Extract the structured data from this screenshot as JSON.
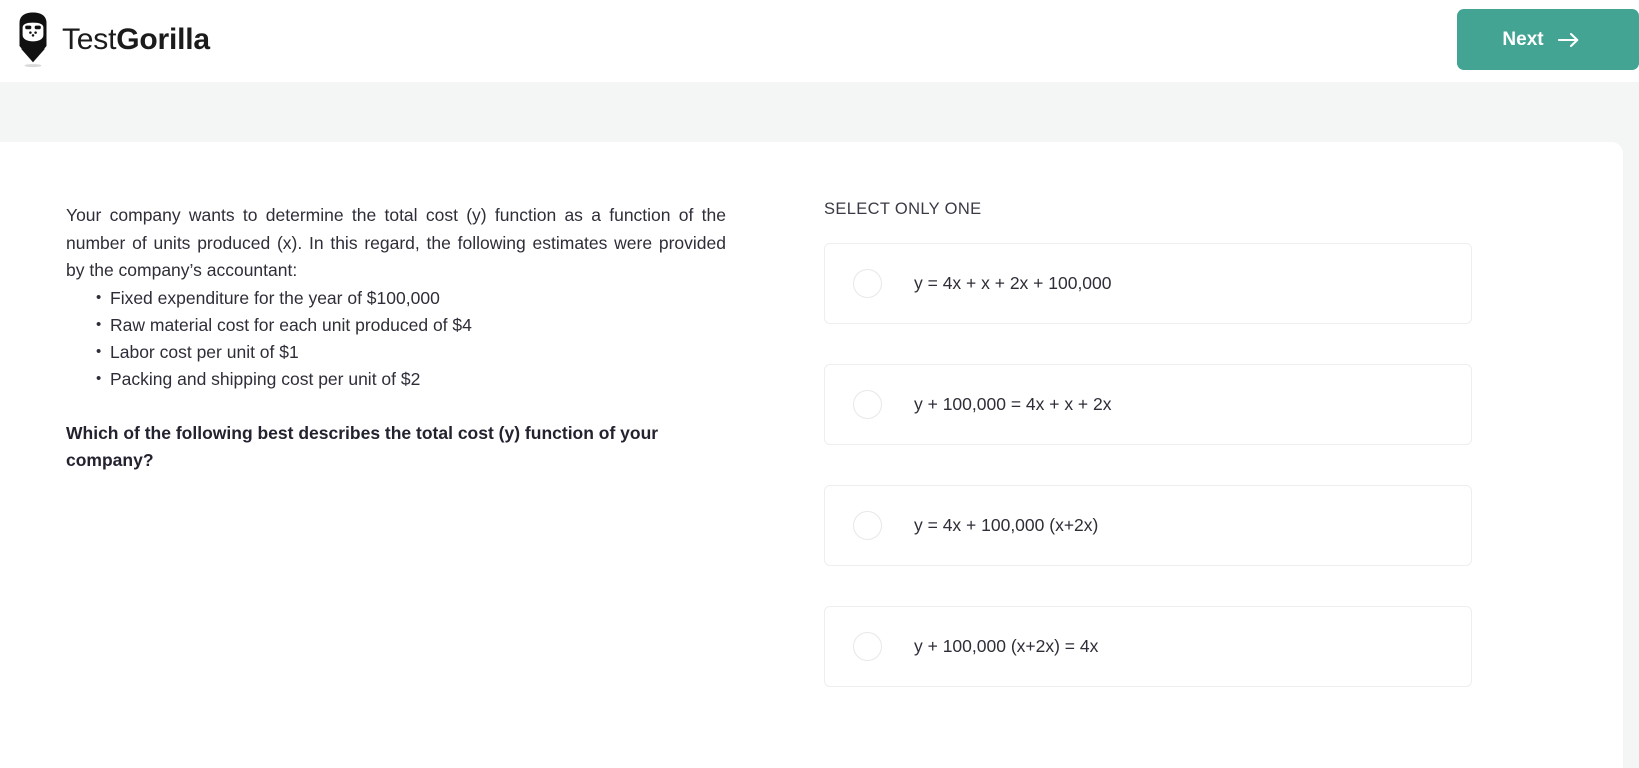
{
  "header": {
    "brand_prefix": "Test",
    "brand_suffix": "Gorilla",
    "logo_icon": "gorilla-logo-icon",
    "next_label": "Next",
    "next_icon": "arrow-right-icon",
    "accent_color": "#43a493"
  },
  "question": {
    "paragraph": "Your company wants to determine the total cost (y) function as a function of the number of units produced (x). In this regard, the following estimates were provided by the company’s accountant:",
    "bullets": [
      "Fixed expenditure for the year of $100,000",
      "Raw material cost for each unit produced of $4",
      "Labor cost per unit of $1",
      "Packing and shipping cost per unit of $2"
    ],
    "prompt": "Which of the following best describes the total cost (y) function of your company?"
  },
  "answers": {
    "select_label": "SELECT ONLY ONE",
    "options": [
      {
        "text": "y = 4x + x + 2x + 100,000",
        "selected": false
      },
      {
        "text": "y + 100,000 = 4x + x + 2x",
        "selected": false
      },
      {
        "text": "y = 4x + 100,000 (x+2x)",
        "selected": false
      },
      {
        "text": "y + 100,000 (x+2x) = 4x",
        "selected": false
      }
    ]
  }
}
